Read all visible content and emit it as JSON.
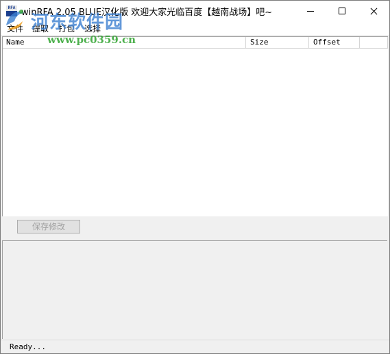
{
  "window": {
    "title": "winRFA 2.05 BLUE汉化版 欢迎大家光临百度【越南战场】吧~",
    "icon_label": "RFA",
    "controls": [
      "minimize-icon",
      "maximize-icon",
      "close-icon"
    ]
  },
  "menu": {
    "items": [
      {
        "label": "文件"
      },
      {
        "label": "提取"
      },
      {
        "label": "打包"
      },
      {
        "label": "选择"
      }
    ]
  },
  "watermark": {
    "site_name": "河东软件园",
    "url": "www.pc0359.cn"
  },
  "list": {
    "columns": [
      "Name",
      "Size",
      "Offset"
    ],
    "rows": []
  },
  "actions": {
    "save_label": "保存修改"
  },
  "status": {
    "text": "Ready..."
  }
}
